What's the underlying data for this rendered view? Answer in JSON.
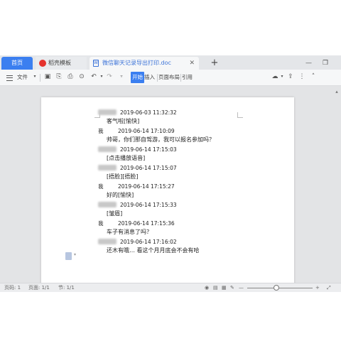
{
  "tabs": {
    "home": "首页",
    "template": "稻壳模板",
    "document": "微信聊天记录导出打印.doc"
  },
  "toolbar": {
    "file": "文件",
    "start": "开始",
    "insert": "插入",
    "layout": "页面布局",
    "reference": "引用"
  },
  "chat": [
    {
      "sender": "",
      "time": "2019-06-03 11:32:32",
      "message": "客气啦[愉快]"
    },
    {
      "sender": "我",
      "time": "2019-06-14 17:10:09",
      "message": "帅哥，你们那自驾游，我可以报名参加吗？"
    },
    {
      "sender": "",
      "time": "2019-06-14 17:15:03",
      "message": "[点击播放语音]"
    },
    {
      "sender": "",
      "time": "2019-06-14 17:15:07",
      "message": "[捂脸][捂脸]"
    },
    {
      "sender": "我",
      "time": "2019-06-14 17:15:27",
      "message": "好的[愉快]"
    },
    {
      "sender": "",
      "time": "2019-06-14 17:15:33",
      "message": "[皱眉]"
    },
    {
      "sender": "我",
      "time": "2019-06-14 17:15:36",
      "message": "车子有消息了吗？"
    },
    {
      "sender": "",
      "time": "2019-06-14 17:16:02",
      "message": "还木有哦… 看这个月月底会不会有哈"
    }
  ],
  "status": {
    "page_no": "页码: 1",
    "pages": "页面: 1/1",
    "section": "节: 1/1"
  },
  "zoom_level": 0.45,
  "icons": {
    "save": "save-icon",
    "print": "print-icon",
    "undo": "undo-icon",
    "redo": "redo-icon",
    "cloud": "cloud-icon"
  },
  "colors": {
    "accent": "#3b7ff0",
    "tab_red": "#e5322d"
  }
}
